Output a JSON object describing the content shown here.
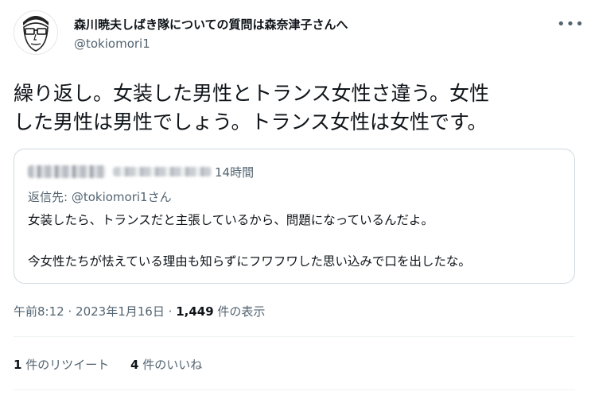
{
  "author": {
    "display_name": "森川暁夫しばき隊についての質問は森奈津子さんへ",
    "handle": "@tokiomori1",
    "more_icon": "more-dots-icon"
  },
  "tweet": {
    "text_line1": "繰り返し。女装した男性とトランス女性さ違う。女性",
    "text_line2": "した男性は男性でしょう。トランス女性は女性です。"
  },
  "quote": {
    "time": "14時間",
    "reply_to": "返信先: @tokiomori1さん",
    "line1": "女装したら、トランスだと主張しているから、問題になっているんだよ。",
    "line2": "今女性たちが怯えている理由も知らずにフワフワした思い込みで口を出したな。"
  },
  "meta": {
    "time": "午前8:12",
    "sep1": "·",
    "date": "2023年1月16日",
    "sep2": "·",
    "views": "1,449",
    "views_label": "件の表示"
  },
  "stats": {
    "retweets": "1",
    "retweets_label": "件のリツイート",
    "likes": "4",
    "likes_label": "件のいいね"
  }
}
